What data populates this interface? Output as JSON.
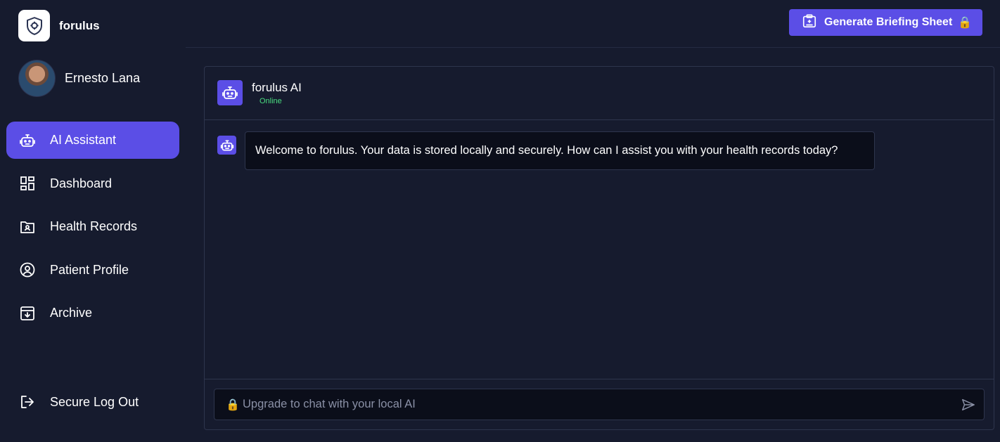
{
  "brand": {
    "name": "forulus",
    "logo_icon": "shield-icon"
  },
  "user": {
    "name": "Ernesto Lana"
  },
  "sidebar": {
    "items": [
      {
        "label": "AI Assistant",
        "icon": "robot-icon",
        "active": true
      },
      {
        "label": "Dashboard",
        "icon": "dashboard-icon",
        "active": false
      },
      {
        "label": "Health Records",
        "icon": "folder-user-icon",
        "active": false
      },
      {
        "label": "Patient Profile",
        "icon": "user-circle-icon",
        "active": false
      },
      {
        "label": "Archive",
        "icon": "archive-icon",
        "active": false
      }
    ],
    "logout_label": "Secure Log Out"
  },
  "topbar": {
    "briefing_label": "Generate Briefing Sheet",
    "briefing_lock": "🔒"
  },
  "chat": {
    "title": "forulus AI",
    "status": "Online",
    "messages": [
      {
        "sender": "bot",
        "text": "Welcome to forulus. Your data is stored locally and securely. How can I assist you with your health records today?"
      }
    ],
    "input_placeholder": "Upgrade to chat with your local AI",
    "input_lock": "🔒"
  },
  "colors": {
    "background": "#161b2e",
    "accent": "#5b4ee6",
    "status_online": "#4ade80",
    "bubble_bg": "#0b0e1a",
    "border": "#2e354d"
  }
}
